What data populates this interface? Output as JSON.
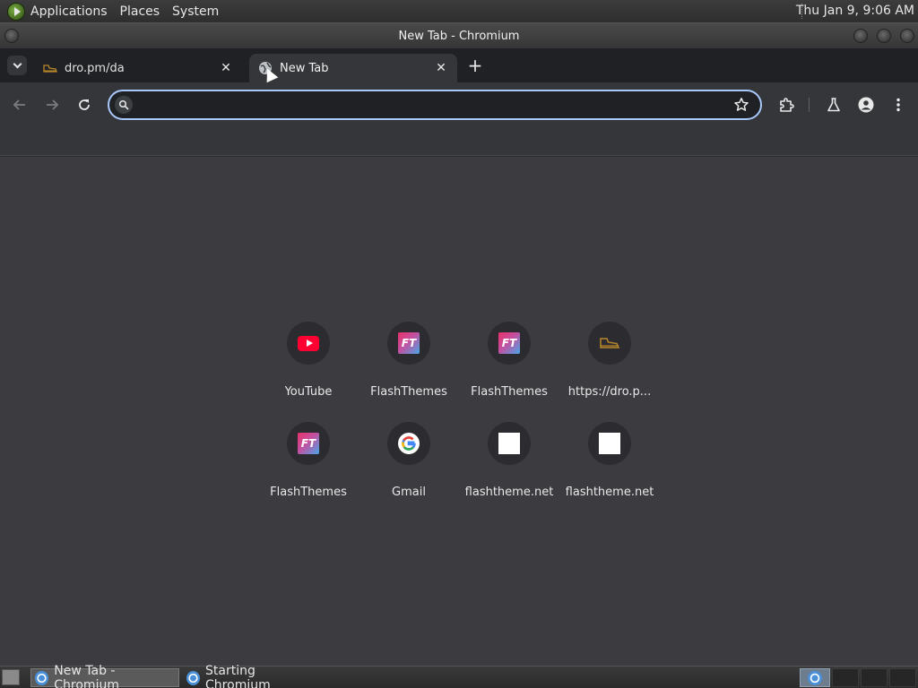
{
  "system_panel": {
    "menus": [
      "Applications",
      "Places",
      "System"
    ],
    "clock": "Thu Jan  9,  9:06 AM"
  },
  "window": {
    "title": "New Tab - Chromium"
  },
  "tabs": [
    {
      "label": "dro.pm/da",
      "icon": "shoe-favicon-icon",
      "active": false
    },
    {
      "label": "New Tab",
      "icon": "globe-icon",
      "active": true
    }
  ],
  "tab_close_glyph": "✕",
  "new_tab_glyph": "+",
  "omnibox": {
    "value": "",
    "placeholder": ""
  },
  "shortcuts": [
    {
      "label": "YouTube",
      "icon": "youtube-icon"
    },
    {
      "label": "FlashThemes",
      "icon": "flashthemes-icon"
    },
    {
      "label": "FlashThemes",
      "icon": "flashthemes-icon"
    },
    {
      "label": "https://dro.p...",
      "icon": "shoe-favicon-icon"
    },
    {
      "label": "FlashThemes",
      "icon": "flashthemes-icon"
    },
    {
      "label": "Gmail",
      "icon": "google-icon"
    },
    {
      "label": "flashtheme.net",
      "icon": "blank-page-icon"
    },
    {
      "label": "flashtheme.net",
      "icon": "blank-page-icon"
    }
  ],
  "ft_logo_text": "FT",
  "taskbar": {
    "items": [
      {
        "label": "New Tab - Chromium",
        "active": true
      },
      {
        "label": "Starting Chromium",
        "active": false
      }
    ]
  },
  "colors": {
    "accent": "#a8c7fa",
    "ntp_background": "#3b3b40",
    "toolbar": "#35363a",
    "tabstrip": "#202124"
  }
}
